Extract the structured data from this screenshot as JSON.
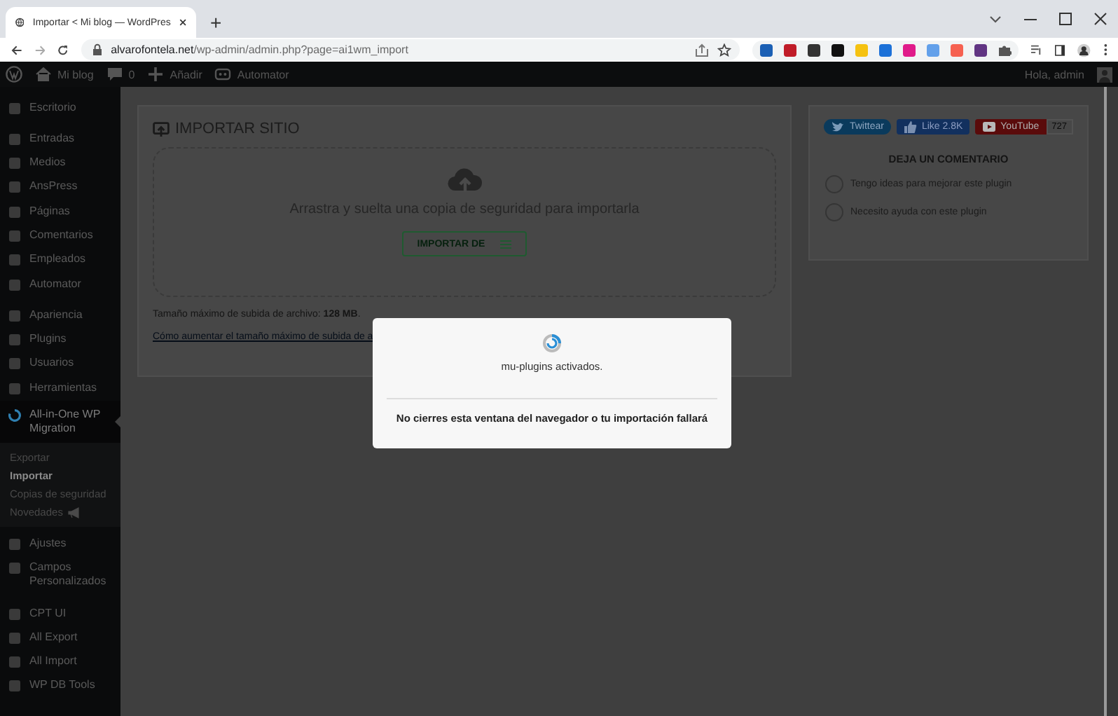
{
  "browser": {
    "tab_title": "Importar < Mi blog — WordPres",
    "new_tab": "+",
    "url": {
      "host": "alvarofontela.net",
      "path": "/wp-admin/admin.php?page=ai1wm_import"
    }
  },
  "admin_bar": {
    "items": [
      {
        "kind": "logo"
      },
      {
        "kind": "site",
        "label": "Mi blog"
      },
      {
        "kind": "comments",
        "label": "0"
      },
      {
        "kind": "new",
        "label": "Añadir"
      },
      {
        "kind": "plugin",
        "label": "Automator"
      }
    ],
    "greeting": "Hola, admin"
  },
  "sidebar": {
    "groups": [
      {
        "items": [
          {
            "label": "Escritorio",
            "selected": false
          }
        ]
      },
      {
        "items": [
          {
            "label": "Entradas",
            "selected": false
          },
          {
            "label": "Medios",
            "selected": false
          },
          {
            "label": "AnsPress",
            "selected": false
          },
          {
            "label": "Páginas",
            "selected": false
          },
          {
            "label": "Comentarios",
            "selected": false
          },
          {
            "label": "Empleados",
            "selected": false
          },
          {
            "label": "Automator",
            "selected": false
          }
        ]
      },
      {
        "items": [
          {
            "label": "Apariencia",
            "selected": false
          },
          {
            "label": "Plugins",
            "selected": false
          },
          {
            "label": "Usuarios",
            "selected": false
          },
          {
            "label": "Herramientas",
            "selected": false
          },
          {
            "label": "All-in-One WP Migration",
            "selected": true,
            "children": [
              {
                "label": "Exportar",
                "selected": false,
                "kind": "link"
              },
              {
                "label": "Importar",
                "selected": true,
                "kind": "link"
              },
              {
                "label": "Copias de seguridad",
                "selected": false,
                "kind": "link"
              },
              {
                "label": "Novedades",
                "selected": false,
                "kind": "announcement"
              }
            ]
          },
          {
            "label": "Ajustes",
            "selected": false
          },
          {
            "label": "Campos Personalizados",
            "selected": false
          }
        ]
      },
      {
        "items": [
          {
            "label": "CPT UI",
            "selected": false
          },
          {
            "label": "All Export",
            "selected": false
          },
          {
            "label": "All Import",
            "selected": false
          },
          {
            "label": "WP DB Tools",
            "selected": false
          }
        ]
      }
    ]
  },
  "import_panel": {
    "title": "IMPORTAR SITIO",
    "drop_text": "Arrastra y suelta una copia de seguridad para importarla",
    "import_button": "IMPORTAR DE",
    "max_size": "Tamaño máximo de subida de archivo: **128 MB**.",
    "help_link": "Cómo aumentar el tamaño máximo de subida de a"
  },
  "side_panel": {
    "social": [
      {
        "kind": "twitter",
        "label": "Twittear"
      },
      {
        "kind": "facebook",
        "label": "Like 2.8K"
      },
      {
        "kind": "youtube",
        "label": "YouTube",
        "count": "727"
      }
    ],
    "heading": "DEJA UN COMENTARIO",
    "options": [
      {
        "label": "Tengo ideas para mejorar este plugin",
        "selected": false
      },
      {
        "label": "Necesito ayuda con este plugin",
        "selected": false
      }
    ]
  },
  "modal": {
    "status": "mu-plugins activados.",
    "warning": "No cierres esta ventana del navegador o tu importación fallará"
  }
}
